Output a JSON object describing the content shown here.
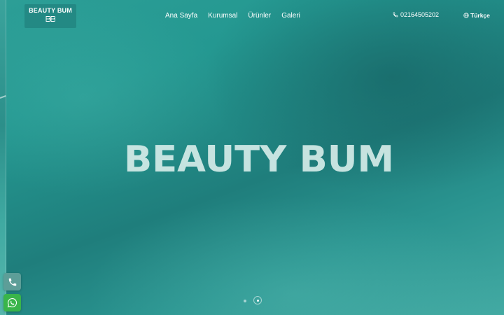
{
  "brand": {
    "name": "BEAUTY BUM",
    "hero_wordmark": "BEAUTY BUM"
  },
  "nav": {
    "items": [
      {
        "label": "Ana Sayfa"
      },
      {
        "label": "Kurumsal"
      },
      {
        "label": "Ürünler"
      },
      {
        "label": "Galeri"
      }
    ]
  },
  "contact": {
    "phone": "02164505202"
  },
  "language": {
    "current": "Türkçe"
  },
  "slider": {
    "slide_count": 2,
    "active_slide": 2
  },
  "floating_buttons": {
    "call_icon": "phone-icon",
    "whatsapp_icon": "whatsapp-icon"
  },
  "colors": {
    "background": "#249891",
    "text": "#ffffff",
    "whatsapp": "#39b54a",
    "call_button": "#5d9e98"
  }
}
